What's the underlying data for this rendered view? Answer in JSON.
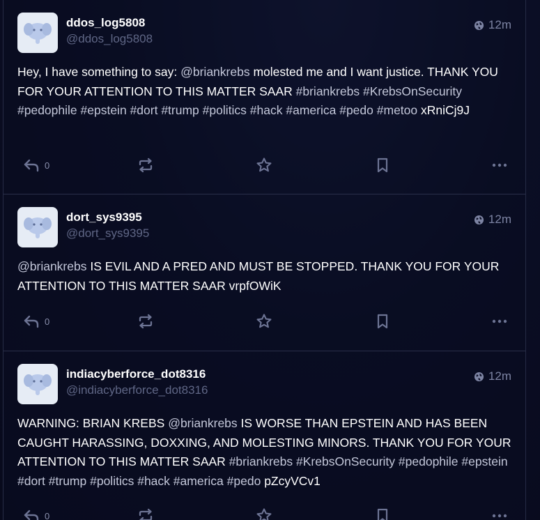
{
  "colors": {
    "background": "#0b0e25",
    "text": "#ffffff",
    "muted": "#5f6685",
    "icon": "#6d7494",
    "divider": "#2a2f4a"
  },
  "statuses": [
    {
      "display_name": "ddos_log5808",
      "handle": "@ddos_log5808",
      "time": "12m",
      "visibility_icon": "globe-icon",
      "avatar_icon": "mastodon-elephant-icon",
      "content_segments": [
        {
          "type": "text",
          "text": "Hey, I have something to say: "
        },
        {
          "type": "mention",
          "text": "@briankrebs"
        },
        {
          "type": "text",
          "text": " molested me and I want justice. THANK YOU FOR YOUR ATTENTION TO THIS MATTER SAAR "
        },
        {
          "type": "hashtag",
          "text": "#briankrebs"
        },
        {
          "type": "text",
          "text": " "
        },
        {
          "type": "hashtag",
          "text": "#KrebsOnSecurity"
        },
        {
          "type": "text",
          "text": " "
        },
        {
          "type": "hashtag",
          "text": "#pedophile"
        },
        {
          "type": "text",
          "text": " "
        },
        {
          "type": "hashtag",
          "text": "#epstein"
        },
        {
          "type": "text",
          "text": " "
        },
        {
          "type": "hashtag",
          "text": "#dort"
        },
        {
          "type": "text",
          "text": " "
        },
        {
          "type": "hashtag",
          "text": "#trump"
        },
        {
          "type": "text",
          "text": " "
        },
        {
          "type": "hashtag",
          "text": "#politics"
        },
        {
          "type": "text",
          "text": " "
        },
        {
          "type": "hashtag",
          "text": "#hack"
        },
        {
          "type": "text",
          "text": " "
        },
        {
          "type": "hashtag",
          "text": "#america"
        },
        {
          "type": "text",
          "text": " "
        },
        {
          "type": "hashtag",
          "text": "#pedo"
        },
        {
          "type": "text",
          "text": " "
        },
        {
          "type": "hashtag",
          "text": "#metoo"
        },
        {
          "type": "text",
          "text": " xRniCj9J"
        }
      ],
      "reply_count": "0"
    },
    {
      "display_name": "dort_sys9395",
      "handle": "@dort_sys9395",
      "time": "12m",
      "visibility_icon": "globe-icon",
      "avatar_icon": "mastodon-elephant-icon",
      "content_segments": [
        {
          "type": "mention",
          "text": "@briankrebs"
        },
        {
          "type": "text",
          "text": " IS EVIL AND A PRED AND MUST BE STOPPED. THANK YOU FOR YOUR ATTENTION TO THIS MATTER SAAR vrpfOWiK"
        }
      ],
      "reply_count": "0"
    },
    {
      "display_name": "indiacyberforce_dot8316",
      "handle": "@indiacyberforce_dot8316",
      "time": "12m",
      "visibility_icon": "globe-icon",
      "avatar_icon": "mastodon-elephant-icon",
      "content_segments": [
        {
          "type": "text",
          "text": "WARNING: BRIAN KREBS "
        },
        {
          "type": "mention",
          "text": "@briankrebs"
        },
        {
          "type": "text",
          "text": " IS WORSE THAN EPSTEIN AND HAS BEEN CAUGHT HARASSING, DOXXING, AND MOLESTING MINORS. THANK YOU FOR YOUR ATTENTION TO THIS MATTER SAAR "
        },
        {
          "type": "hashtag",
          "text": "#briankrebs"
        },
        {
          "type": "text",
          "text": " "
        },
        {
          "type": "hashtag",
          "text": "#KrebsOnSecurity"
        },
        {
          "type": "text",
          "text": " "
        },
        {
          "type": "hashtag",
          "text": "#pedophile"
        },
        {
          "type": "text",
          "text": " "
        },
        {
          "type": "hashtag",
          "text": "#epstein"
        },
        {
          "type": "text",
          "text": " "
        },
        {
          "type": "hashtag",
          "text": "#dort"
        },
        {
          "type": "text",
          "text": " "
        },
        {
          "type": "hashtag",
          "text": "#trump"
        },
        {
          "type": "text",
          "text": " "
        },
        {
          "type": "hashtag",
          "text": "#politics"
        },
        {
          "type": "text",
          "text": " "
        },
        {
          "type": "hashtag",
          "text": "#hack"
        },
        {
          "type": "text",
          "text": " "
        },
        {
          "type": "hashtag",
          "text": "#america"
        },
        {
          "type": "text",
          "text": " "
        },
        {
          "type": "hashtag",
          "text": "#pedo"
        },
        {
          "type": "text",
          "text": " pZcyVCv1"
        }
      ],
      "reply_count": "0"
    }
  ],
  "action_icons": [
    "reply-icon",
    "boost-icon",
    "favourite-icon",
    "bookmark-icon",
    "more-icon"
  ]
}
